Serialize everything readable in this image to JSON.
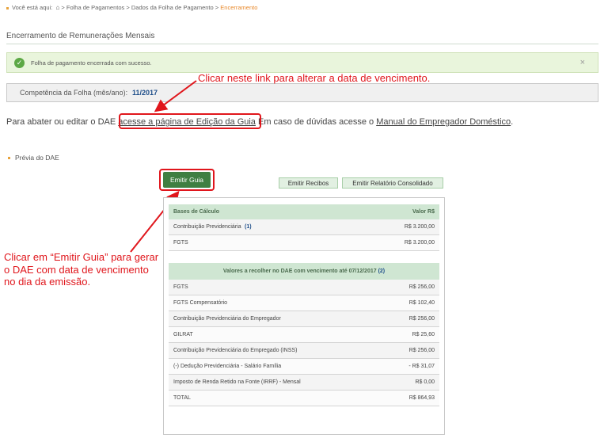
{
  "breadcrumb": {
    "label": "Você está aqui:",
    "sep1": ">",
    "item1": "Folha de Pagamentos",
    "sep2": ">",
    "item2": "Dados da Folha de Pagamento",
    "sep3": ">",
    "current": "Encerramento"
  },
  "page": {
    "title": "Encerramento de Remunerações Mensais"
  },
  "alert": {
    "message": "Folha de pagamento encerrada com sucesso.",
    "close": "×"
  },
  "competencia": {
    "label": "Competência da Folha (mês/ano):",
    "value": "11/2017"
  },
  "info": {
    "pre": "Para abater ou editar o DAE ",
    "link1": "acesse a página de Edição da Guia",
    "mid": " Em caso de dúvidas acesse o ",
    "link2": "Manual do Empregador Doméstico",
    "post": "."
  },
  "annotations": {
    "link_hint": "Clicar neste link para alterar a data de vencimento.",
    "button_hint": "Clicar em “Emitir Guia” para gerar o DAE com data de vencimento no dia da emissão."
  },
  "previa": {
    "title": "Prévia do DAE"
  },
  "buttons": {
    "emitir_guia": "Emitir Guia",
    "emitir_recibos": "Emitir Recibos",
    "emitir_relatorio": "Emitir Relatório Consolidado"
  },
  "table1": {
    "header_left": "Bases de Cálculo",
    "header_right": "Valor R$",
    "rows": [
      {
        "label": "Contribuição Previdenciária",
        "ref": "(1)",
        "value": "R$ 3.200,00"
      },
      {
        "label": "FGTS",
        "ref": "",
        "value": "R$ 3.200,00"
      }
    ]
  },
  "table2": {
    "header": "Valores a recolher no DAE com vencimento até 07/12/2017",
    "header_ref": "(2)",
    "rows": [
      {
        "label": "FGTS",
        "value": "R$ 256,00"
      },
      {
        "label": "FGTS Compensatório",
        "value": "R$ 102,40"
      },
      {
        "label": "Contribuição Previdenciária do Empregador",
        "value": "R$ 256,00"
      },
      {
        "label": "GILRAT",
        "value": "R$ 25,60"
      },
      {
        "label": "Contribuição Previdenciária do Empregado (INSS)",
        "value": "R$ 256,00"
      },
      {
        "label": "(-) Dedução Previdenciária - Salário Família",
        "value": "- R$ 31,07"
      },
      {
        "label": "Imposto de Renda Retido na Fonte (IRRF) - Mensal",
        "value": "R$ 0,00"
      },
      {
        "label": "TOTAL",
        "value": "R$ 864,93"
      }
    ]
  },
  "colors": {
    "annotation_red": "#e0161c",
    "primary_green": "#3f7f42",
    "header_green": "#cfe6d2",
    "alert_bg": "#e9f5dc"
  },
  "icons": {
    "home": "home-icon",
    "check": "check-circle-icon"
  }
}
